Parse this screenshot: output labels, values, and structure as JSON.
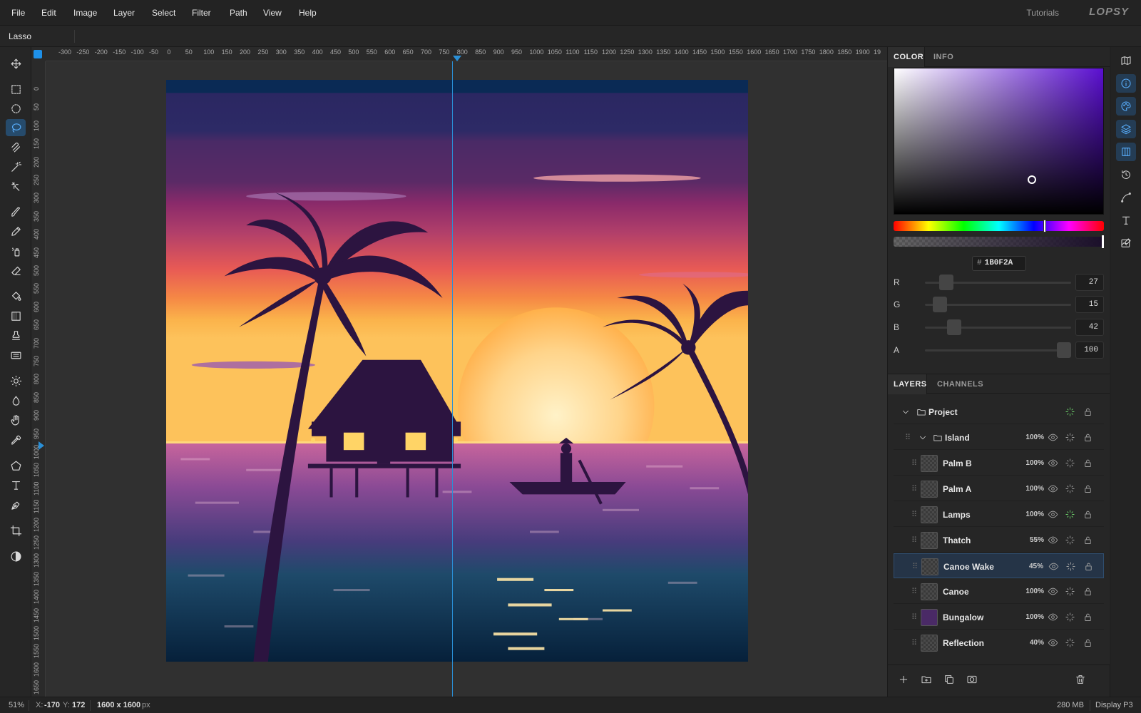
{
  "menu": [
    "File",
    "Edit",
    "Image",
    "Layer",
    "Select",
    "Filter",
    "Path",
    "View",
    "Help"
  ],
  "header": {
    "tutorials": "Tutorials",
    "logo": "LOPSY"
  },
  "options": {
    "tool_name": "Lasso"
  },
  "tools": [
    {
      "name": "move-tool",
      "icon": "move-icon"
    },
    {
      "name": "rect-select-tool",
      "icon": "rect-select-icon"
    },
    {
      "name": "ellipse-select-tool",
      "icon": "ellipse-select-icon"
    },
    {
      "name": "lasso-tool",
      "icon": "lasso-icon",
      "active": true
    },
    {
      "name": "magnetic-lasso-tool",
      "icon": "magnetic-lasso-icon"
    },
    {
      "name": "magic-wand-tool",
      "icon": "magic-wand-icon"
    },
    {
      "name": "quick-select-tool",
      "icon": "quick-select-icon"
    },
    {
      "name": "brush-tool",
      "icon": "brush-icon"
    },
    {
      "name": "pencil-tool",
      "icon": "pencil-icon"
    },
    {
      "name": "spray-tool",
      "icon": "spray-icon"
    },
    {
      "name": "eraser-tool",
      "icon": "eraser-icon"
    },
    {
      "name": "bucket-tool",
      "icon": "bucket-icon"
    },
    {
      "name": "gradient-tool",
      "icon": "gradient-icon"
    },
    {
      "name": "stamp-tool",
      "icon": "stamp-icon"
    },
    {
      "name": "pattern-tool",
      "icon": "pattern-icon"
    },
    {
      "name": "dodge-tool",
      "icon": "sun-icon"
    },
    {
      "name": "blur-tool",
      "icon": "drop-icon"
    },
    {
      "name": "smudge-tool",
      "icon": "hand-icon"
    },
    {
      "name": "eyedropper-tool",
      "icon": "eyedropper-icon"
    },
    {
      "name": "shape-tool",
      "icon": "pentagon-icon"
    },
    {
      "name": "text-tool",
      "icon": "text-icon"
    },
    {
      "name": "pen-tool",
      "icon": "pen-icon"
    },
    {
      "name": "crop-tool",
      "icon": "crop-icon"
    },
    {
      "name": "contrast-tool",
      "icon": "contrast-icon"
    }
  ],
  "ruler": {
    "top": [
      "-300",
      "-250",
      "-200",
      "-150",
      "-100",
      "-50",
      "0",
      "50",
      "100",
      "150",
      "200",
      "250",
      "300",
      "350",
      "400",
      "450",
      "500",
      "550",
      "600",
      "650",
      "700",
      "750",
      "800",
      "850",
      "900",
      "950",
      "1000",
      "1050",
      "1100",
      "1150",
      "1200",
      "1250",
      "1300",
      "1350",
      "1400",
      "1450",
      "1500",
      "1550",
      "1600",
      "1650",
      "1700",
      "1750",
      "1800",
      "1850",
      "1900",
      "19"
    ],
    "left": [
      "0",
      "50",
      "100",
      "150",
      "200",
      "250",
      "300",
      "350",
      "400",
      "450",
      "500",
      "550",
      "600",
      "650",
      "700",
      "750",
      "800",
      "850",
      "900",
      "950",
      "1000",
      "1050",
      "1100",
      "1150",
      "1200",
      "1250",
      "1300",
      "1350",
      "1400",
      "1450",
      "1500",
      "1550",
      "1600",
      "1650"
    ]
  },
  "color_panel": {
    "tabs": [
      "COLOR",
      "INFO"
    ],
    "hex": "1B0F2A",
    "channels": [
      {
        "label": "R",
        "value": "27",
        "fraction": 0.106
      },
      {
        "label": "G",
        "value": "15",
        "fraction": 0.059
      },
      {
        "label": "B",
        "value": "42",
        "fraction": 0.165
      },
      {
        "label": "A",
        "value": "100",
        "fraction": 1.0
      }
    ],
    "colors": {
      "current": "#1b0f2a",
      "hue": "#5a0fd0"
    }
  },
  "layers_panel": {
    "tabs": [
      "LAYERS",
      "CHANNELS"
    ],
    "items": [
      {
        "name": "Project",
        "type": "group",
        "level": 0,
        "opacity": "",
        "expanded": true
      },
      {
        "name": "Island",
        "type": "group",
        "level": 1,
        "opacity": "100%",
        "expanded": true
      },
      {
        "name": "Palm B",
        "type": "layer",
        "opacity": "100%"
      },
      {
        "name": "Palm A",
        "type": "layer",
        "opacity": "100%"
      },
      {
        "name": "Lamps",
        "type": "layer",
        "opacity": "100%",
        "fx": true
      },
      {
        "name": "Thatch",
        "type": "layer",
        "opacity": "55%"
      },
      {
        "name": "Canoe Wake",
        "type": "layer",
        "opacity": "45%",
        "selected": true
      },
      {
        "name": "Canoe",
        "type": "layer",
        "opacity": "100%"
      },
      {
        "name": "Bungalow",
        "type": "layer",
        "opacity": "100%"
      },
      {
        "name": "Reflection",
        "type": "layer",
        "opacity": "40%"
      }
    ]
  },
  "status": {
    "zoom": "51%",
    "x_label": "X:",
    "x": "-170",
    "y_label": "Y:",
    "y": "172",
    "size": "1600 x 1600",
    "unit": "px",
    "memory": "280 MB",
    "display": "Display P3"
  }
}
